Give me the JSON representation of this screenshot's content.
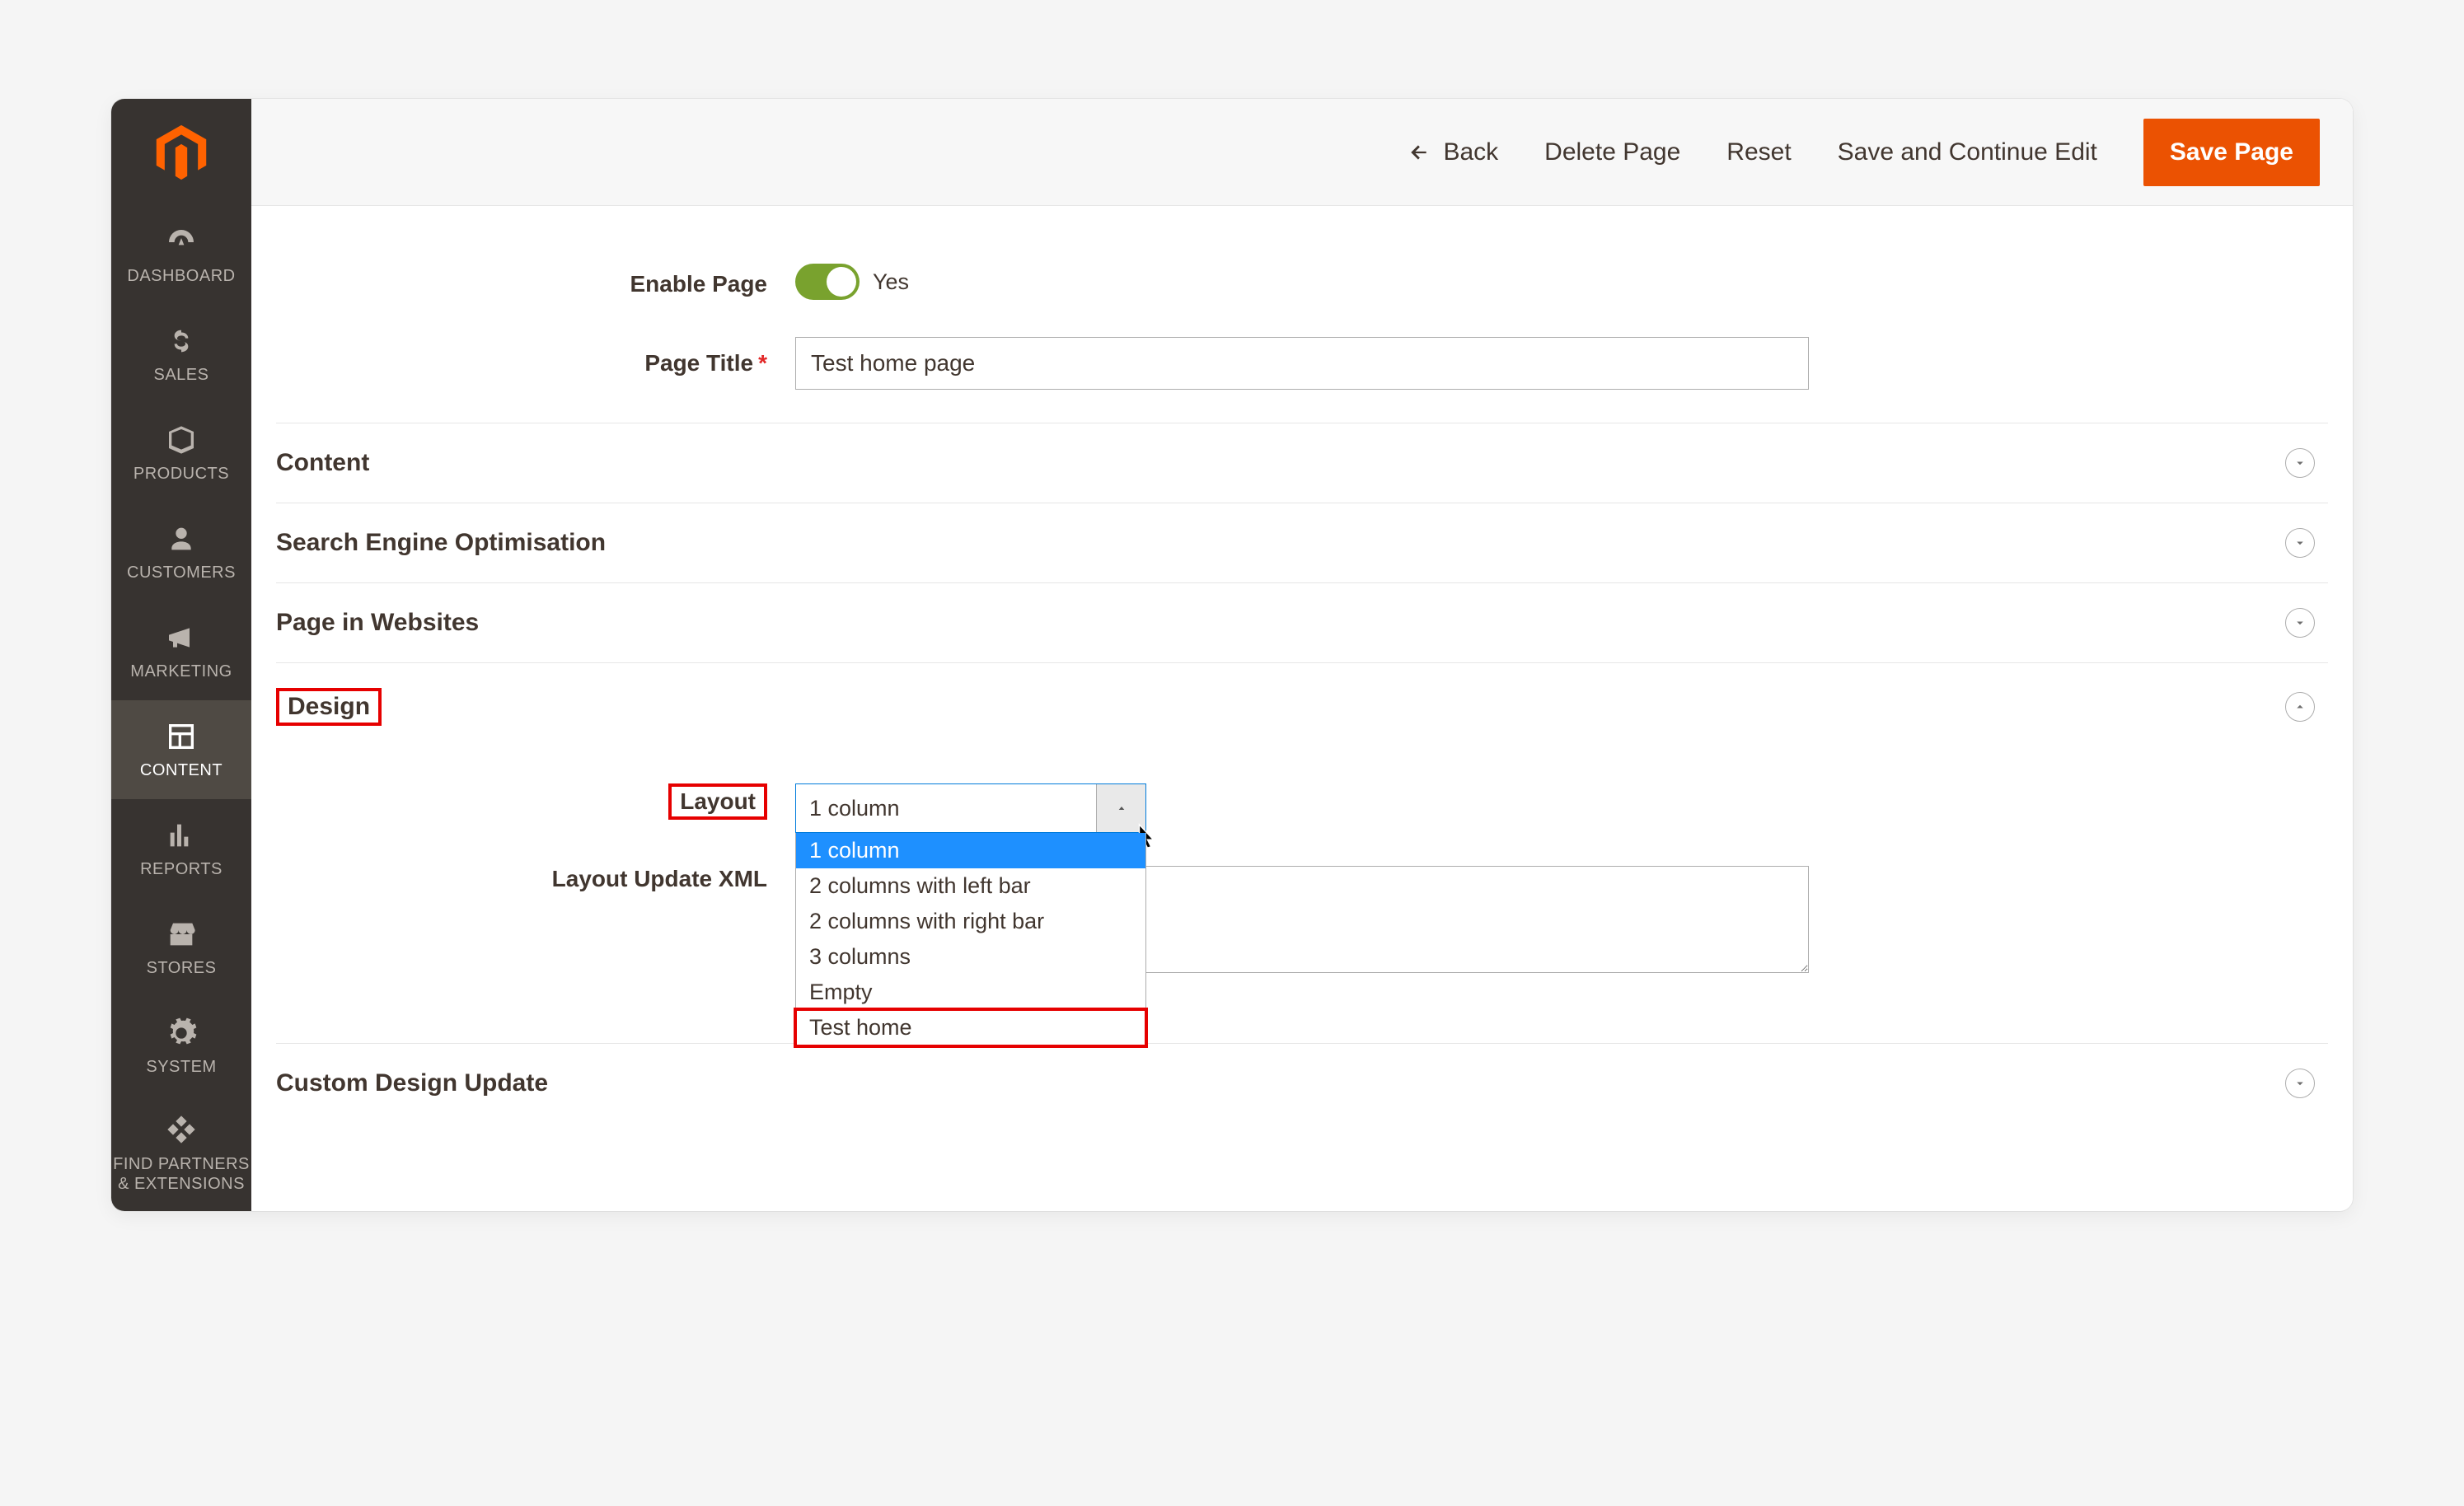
{
  "sidebar": {
    "items": [
      {
        "id": "dashboard",
        "label": "DASHBOARD"
      },
      {
        "id": "sales",
        "label": "SALES"
      },
      {
        "id": "products",
        "label": "PRODUCTS"
      },
      {
        "id": "customers",
        "label": "CUSTOMERS"
      },
      {
        "id": "marketing",
        "label": "MARKETING"
      },
      {
        "id": "content",
        "label": "CONTENT"
      },
      {
        "id": "reports",
        "label": "REPORTS"
      },
      {
        "id": "stores",
        "label": "STORES"
      },
      {
        "id": "system",
        "label": "SYSTEM"
      },
      {
        "id": "find",
        "label": "FIND PARTNERS & EXTENSIONS"
      }
    ]
  },
  "topbar": {
    "back": "Back",
    "delete": "Delete Page",
    "reset": "Reset",
    "save_continue": "Save and Continue Edit",
    "save": "Save Page"
  },
  "form": {
    "enable_label": "Enable Page",
    "enable_state": "Yes",
    "title_label": "Page Title",
    "title_value": "Test home page"
  },
  "fieldsets": {
    "content": "Content",
    "seo": "Search Engine Optimisation",
    "piw": "Page in Websites",
    "design": "Design",
    "custom": "Custom Design Update"
  },
  "design": {
    "layout_label": "Layout",
    "layout_selected": "1 column",
    "layout_options": [
      "1 column",
      "2 columns with left bar",
      "2 columns with right bar",
      "3 columns",
      "Empty",
      "Test home"
    ],
    "xml_label": "Layout Update XML",
    "xml_value": ""
  }
}
